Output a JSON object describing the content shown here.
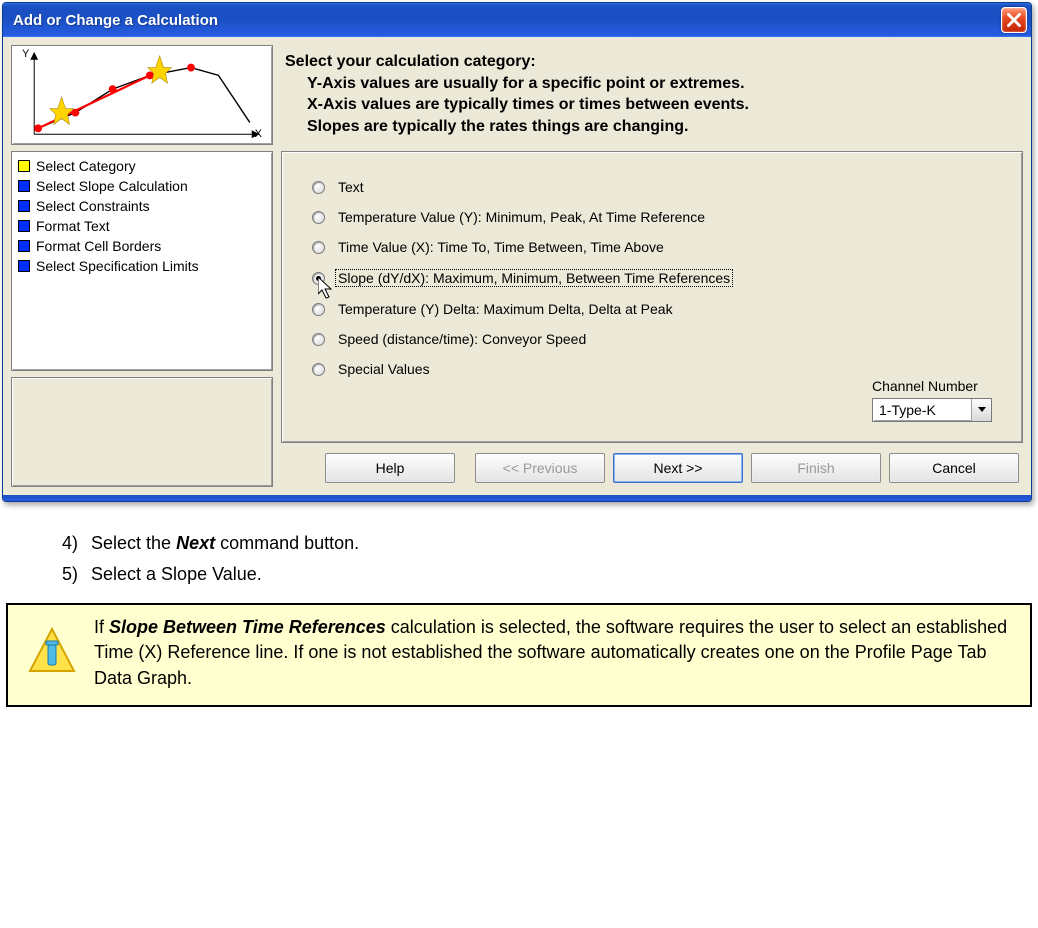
{
  "window": {
    "title": "Add or Change a Calculation"
  },
  "preview": {
    "y_label": "Y",
    "x_label": "X"
  },
  "steps": [
    {
      "color": "yellow",
      "label": "Select Category"
    },
    {
      "color": "blue",
      "label": "Select Slope Calculation"
    },
    {
      "color": "blue",
      "label": "Select Constraints"
    },
    {
      "color": "blue",
      "label": "Format Text"
    },
    {
      "color": "blue",
      "label": "Format Cell Borders"
    },
    {
      "color": "blue",
      "label": "Select Specification Limits"
    }
  ],
  "heading": {
    "main": "Select your calculation category:",
    "line1": "Y-Axis values are usually for a specific point or extremes.",
    "line2": "X-Axis values are typically times or times between events.",
    "line3": "Slopes are typically the rates things are changing."
  },
  "radios": [
    {
      "label": "Text",
      "selected": false
    },
    {
      "label": "Temperature Value (Y):  Minimum, Peak, At Time Reference",
      "selected": false
    },
    {
      "label": "Time Value (X):  Time To, Time Between, Time Above",
      "selected": false
    },
    {
      "label": "Slope (dY/dX):  Maximum, Minimum, Between Time References",
      "selected": true
    },
    {
      "label": "Temperature (Y) Delta:  Maximum Delta, Delta at Peak",
      "selected": false
    },
    {
      "label": "Speed (distance/time): Conveyor Speed",
      "selected": false
    },
    {
      "label": "Special  Values",
      "selected": false
    }
  ],
  "channel": {
    "label": "Channel Number",
    "value": "1-Type-K"
  },
  "buttons": {
    "help": "Help",
    "previous": "<< Previous",
    "next": "Next >>",
    "finish": "Finish",
    "cancel": "Cancel"
  },
  "instructions": {
    "step4_num": "4)",
    "step4_pre": "Select the ",
    "step4_bold": "Next",
    "step4_post": " command button.",
    "step5_num": "5)",
    "step5_text": "Select a Slope Value."
  },
  "note": {
    "pre": "If ",
    "bold": "Slope Between Time References",
    "post": " calculation is selected, the software requires the user to select an established Time (X) Reference line. If one is not established the software automatically creates one on the Profile Page Tab Data Graph."
  }
}
